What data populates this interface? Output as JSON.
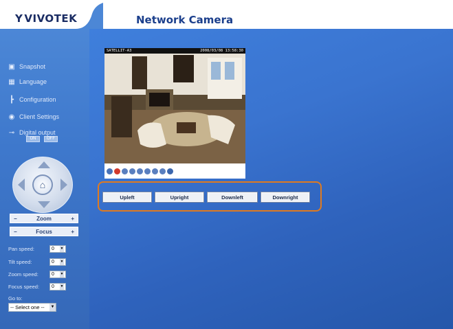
{
  "header": {
    "logo": "VIVOTEK",
    "title": "Network Camera"
  },
  "sidebar": {
    "menu": [
      {
        "label": "Snapshot",
        "icon": "camera-icon"
      },
      {
        "label": "Language",
        "icon": "keyboard-icon"
      },
      {
        "label": "Configuration",
        "icon": "tools-icon"
      },
      {
        "label": "Client Settings",
        "icon": "globe-icon"
      },
      {
        "label": "Digital output",
        "icon": "plug-icon"
      }
    ],
    "digital_output": {
      "on": "ON",
      "off": "OFF"
    },
    "zoom": {
      "label": "Zoom",
      "minus": "−",
      "plus": "+"
    },
    "focus": {
      "label": "Focus",
      "minus": "−",
      "plus": "+"
    },
    "speeds": [
      {
        "label": "Pan speed:",
        "value": "0"
      },
      {
        "label": "Tilt speed:",
        "value": "0"
      },
      {
        "label": "Zoom speed:",
        "value": "0"
      },
      {
        "label": "Focus speed:",
        "value": "0"
      }
    ],
    "goto": {
      "label": "Go to:",
      "value": "-- Select one --"
    }
  },
  "video": {
    "camera_name": "SATELLIT-A3",
    "timestamp": "2008/03/08 13:58:30"
  },
  "presets": [
    "Upleft",
    "Upright",
    "Downleft",
    "Downright"
  ],
  "colors": {
    "highlight": "#e07a1f",
    "background": "#3a74d0"
  }
}
